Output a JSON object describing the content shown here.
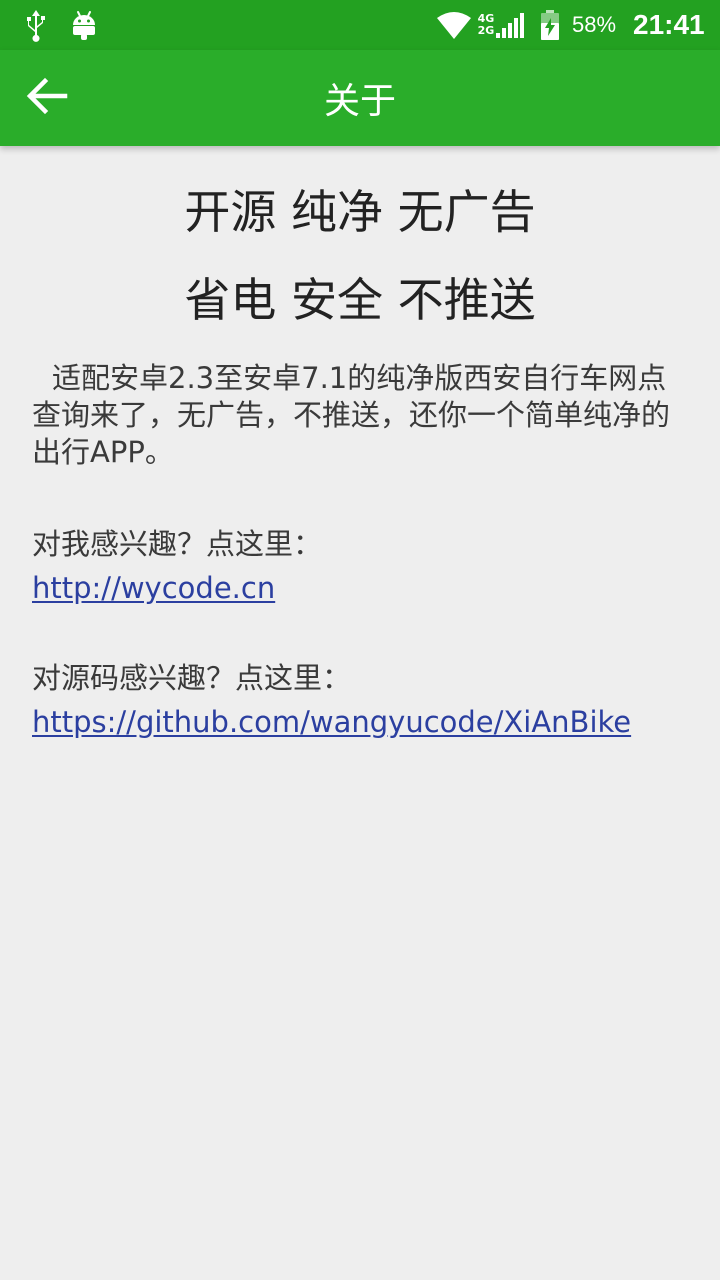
{
  "status_bar": {
    "network_top": "4G",
    "network_bottom": "2G",
    "battery_percent": "58%",
    "time": "21:41",
    "icons": [
      "usb-icon",
      "android-icon",
      "wifi-icon",
      "signal-icon",
      "battery-icon"
    ]
  },
  "app_bar": {
    "title": "关于",
    "back_icon": "arrow-left-icon"
  },
  "content": {
    "headline_1": "开源 纯净 无广告",
    "headline_2": "省电 安全 不推送",
    "description": "适配安卓2.3至安卓7.1的纯净版西安自行车网点查询来了，无广告，不推送，还你一个简单纯净的出行APP。",
    "author_label": "对我感兴趣？点这里：",
    "author_link": "http://wycode.cn",
    "source_label": "对源码感兴趣？点这里：",
    "source_link": "https://github.com/wangyucode/XiAnBike"
  },
  "colors": {
    "status_bar": "#23a121",
    "app_bar": "#2aad2a",
    "background": "#eeeeee",
    "link": "#2b3fa0",
    "text": "#3a3a3a"
  }
}
